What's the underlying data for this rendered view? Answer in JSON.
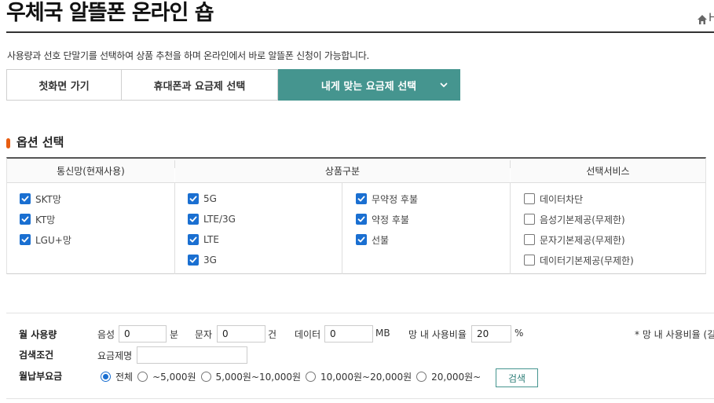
{
  "header": {
    "title": "우체국 알뜰폰 온라인 숍",
    "trail_text": "H",
    "description": "사용량과 선호 단말기를 선택하여 상품 추천을 하며 온라인에서 바로 알뜰폰 신청이 가능합니다."
  },
  "tabs": [
    {
      "label": "첫화면 가기"
    },
    {
      "label": "휴대폰과 요금제 선택"
    },
    {
      "label": "내게 맞는 요금제 선택"
    }
  ],
  "options": {
    "section_title": "옵션 선택",
    "headers": {
      "network": "통신망(현재사용)",
      "product": "상품구분",
      "service": "선택서비스"
    },
    "network": [
      {
        "label": "SKT망",
        "checked": true
      },
      {
        "label": "KT망",
        "checked": true
      },
      {
        "label": "LGU+망",
        "checked": true
      }
    ],
    "product_type": [
      {
        "label": "5G",
        "checked": true
      },
      {
        "label": "LTE/3G",
        "checked": true
      },
      {
        "label": "LTE",
        "checked": true
      },
      {
        "label": "3G",
        "checked": true
      }
    ],
    "contract": [
      {
        "label": "무약정 후불",
        "checked": true
      },
      {
        "label": "약정 후불",
        "checked": true
      },
      {
        "label": "선불",
        "checked": true
      }
    ],
    "service": [
      {
        "label": "데이터차단",
        "checked": false
      },
      {
        "label": "음성기본제공(무제한)",
        "checked": false
      },
      {
        "label": "문자기본제공(무제한)",
        "checked": false
      },
      {
        "label": "데이터기본제공(무제한)",
        "checked": false
      }
    ]
  },
  "search": {
    "usage_label": "월 사용량",
    "voice_label": "음성",
    "voice_value": "0",
    "voice_unit": "분",
    "sms_label": "문자",
    "sms_value": "0",
    "sms_unit": "건",
    "data_label": "데이터",
    "data_value": "0",
    "data_unit": "MB",
    "ratio_label": "망 내 사용비율",
    "ratio_value": "20",
    "ratio_unit": "%",
    "ratio_note": "* 망 내 사용비율 (길",
    "condition_label": "검색조건",
    "plan_name_label": "요금제명",
    "plan_name_value": "",
    "fee_label": "월납부요금",
    "fee_options": [
      {
        "label": "전체",
        "selected": true
      },
      {
        "label": "~5,000원",
        "selected": false
      },
      {
        "label": "5,000원~10,000원",
        "selected": false
      },
      {
        "label": "10,000원~20,000원",
        "selected": false
      },
      {
        "label": "20,000원~",
        "selected": false
      }
    ],
    "search_button": "검색"
  },
  "colors": {
    "accent": "#45958f",
    "check_blue": "#1a6fd1",
    "marker_orange": "#e85d11"
  }
}
